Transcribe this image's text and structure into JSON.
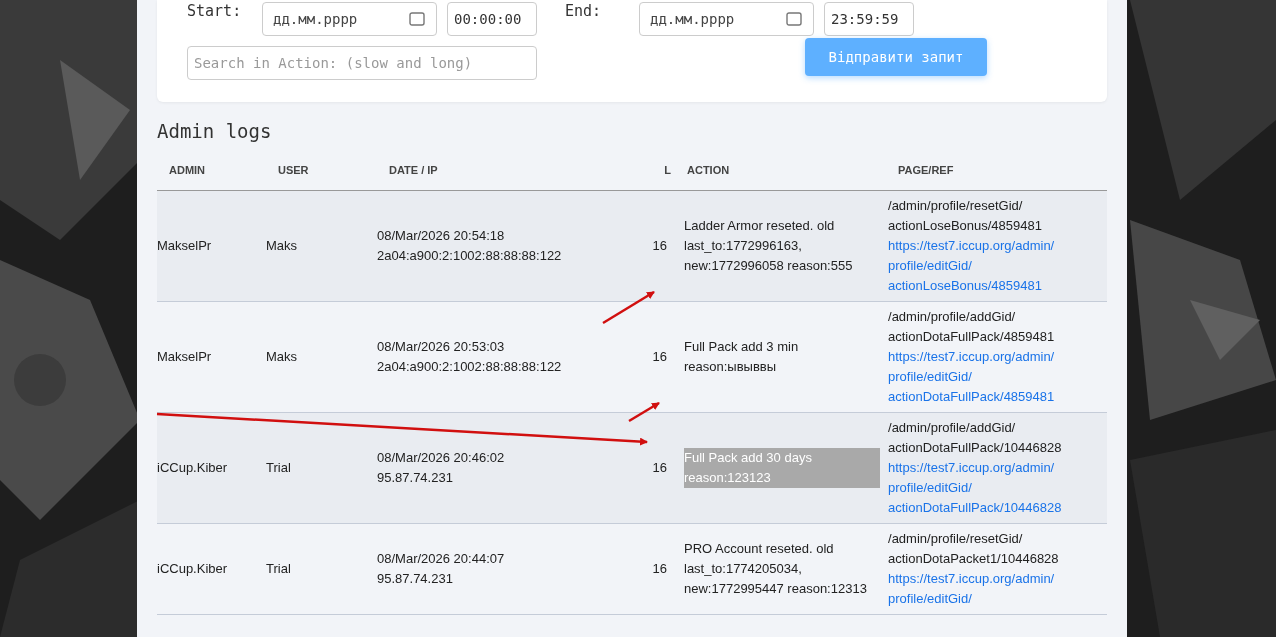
{
  "filters": {
    "start_label": "Start:",
    "start_date": {
      "placeholder": "дд.мм.рррр"
    },
    "start_time": {
      "value": "00:00:00"
    },
    "end_label": "End:",
    "end_date": {
      "placeholder": "дд.мм.рррр"
    },
    "end_time": {
      "value": "23:59:59"
    },
    "search": {
      "placeholder": "Search in Action: (slow and long)"
    },
    "submit_button": "Відправити запит"
  },
  "section_title": "Admin logs",
  "table": {
    "columns": [
      "ADMIN",
      "USER",
      "DATE / IP",
      "L",
      "ACTION",
      "PAGE/REF"
    ],
    "rows": [
      {
        "admin": "MakselPr",
        "user": "Maks",
        "date": "08/Mar/2026 20:54:18",
        "ip": "2a04:a900:2:1002:88:88:88:122",
        "l": "16",
        "action": "Ladder Armor reseted. old last_to:1772996163, new:1772996058 reason:555",
        "action_selected": false,
        "path": "/admin/profile/resetGid/actionLoseBonus/4859481",
        "link": "https://test7.iccup.org/admin/profile/editGid/actionLoseBonus/4859481"
      },
      {
        "admin": "MakselPr",
        "user": "Maks",
        "date": "08/Mar/2026 20:53:03",
        "ip": "2a04:a900:2:1002:88:88:88:122",
        "l": "16",
        "action": "Full Pack add 3 min reason:ывыввы",
        "action_selected": false,
        "path": "/admin/profile/addGid/actionDotaFullPack/4859481",
        "link": "https://test7.iccup.org/admin/profile/editGid/actionDotaFullPack/4859481"
      },
      {
        "admin": "iCCup.Kiber",
        "user": "Trial",
        "date": "08/Mar/2026 20:46:02",
        "ip": "95.87.74.231",
        "l": "16",
        "action": "Full Pack add 30 days reason:123123",
        "action_selected": true,
        "path": "/admin/profile/addGid/actionDotaFullPack/10446828",
        "link": "https://test7.iccup.org/admin/profile/editGid/actionDotaFullPack/10446828"
      },
      {
        "admin": "iCCup.Kiber",
        "user": "Trial",
        "date": "08/Mar/2026 20:44:07",
        "ip": "95.87.74.231",
        "l": "16",
        "action": "PRO Account reseted. old last_to:1774205034, new:1772995447 reason:12313",
        "action_selected": false,
        "path": "/admin/profile/resetGid/actionDotaPacket1/10446828",
        "link": "https://test7.iccup.org/admin/profile/editGid/"
      }
    ]
  }
}
